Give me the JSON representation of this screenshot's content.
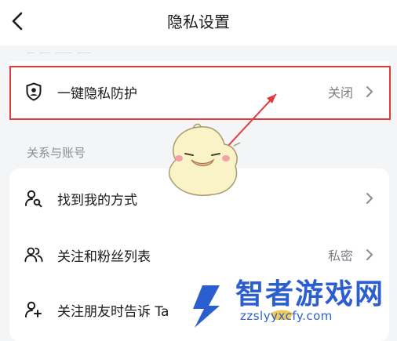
{
  "header": {
    "title": "隐私设置",
    "back_icon": "chevron-left-icon"
  },
  "privacy_protection": {
    "label": "一键隐私防护",
    "value": "关闭",
    "icon": "shield-person-icon",
    "highlight_color": "#e23b3b"
  },
  "section": {
    "title": "关系与账号"
  },
  "settings_items": [
    {
      "label": "找到我的方式",
      "value": "",
      "icon": "person-search-icon"
    },
    {
      "label": "关注和粉丝列表",
      "value": "私密",
      "icon": "people-icon"
    },
    {
      "label": "关注朋友时告诉 Ta",
      "value": "",
      "icon": "person-add-icon"
    }
  ],
  "watermark": {
    "brand": "智者游戏网",
    "url": "zzslyyxcfy.com"
  },
  "colors": {
    "background": "#f4f5f7",
    "card": "#ffffff",
    "text": "#1a1a1a",
    "secondary_text": "#7b7d82",
    "annotation_red": "#e23b3b",
    "watermark_blue": "#2b5fd0"
  }
}
